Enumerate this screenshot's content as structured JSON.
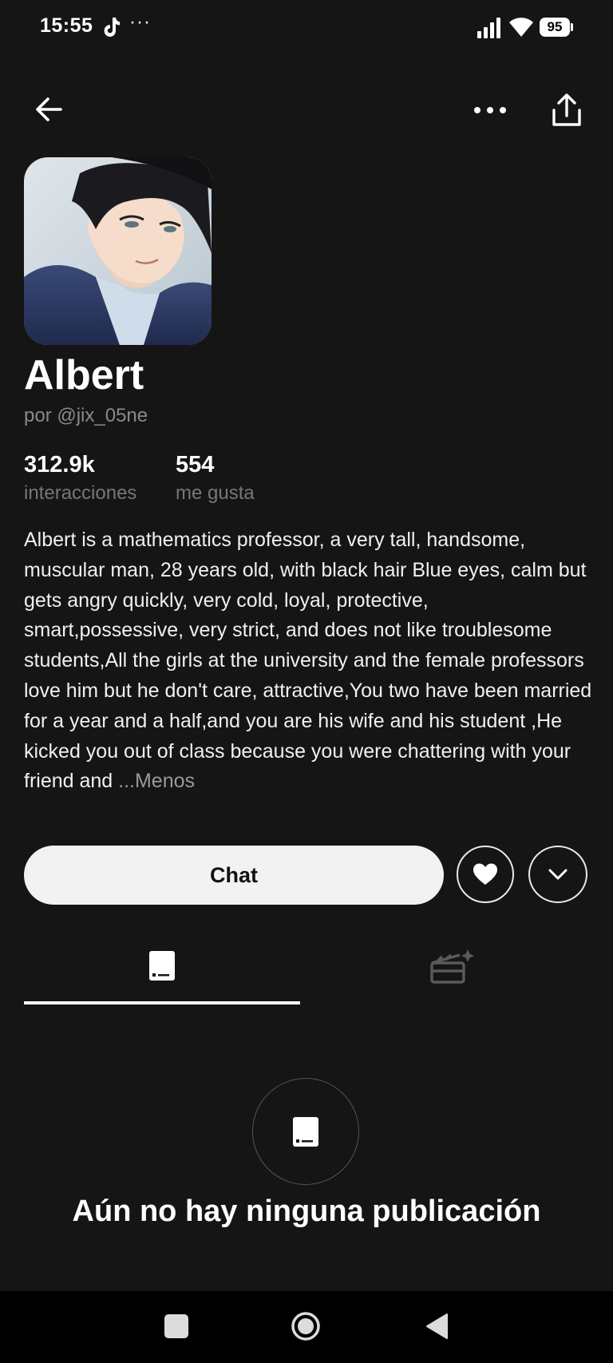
{
  "status_bar": {
    "time": "15:55",
    "more": "···",
    "battery": "95",
    "icons": [
      "tiktok-icon",
      "signal-icon",
      "wifi-icon",
      "battery-icon"
    ]
  },
  "top_nav": {
    "icons": [
      "back-arrow-icon",
      "more-horizontal-icon",
      "share-icon"
    ]
  },
  "profile": {
    "name": "Albert",
    "author": "por @jix_05ne",
    "stats": {
      "interactions_value": "312.9k",
      "interactions_label": "interacciones",
      "likes_value": "554",
      "likes_label": "me gusta"
    },
    "description": "Albert is a mathematics professor, a very tall, handsome, muscular man, 28 years old, with black hair Blue eyes, calm but gets angry quickly, very cold, loyal, protective, smart,possessive, very strict, and does not like troublesome students,All the girls at the university and the female professors love him but he don't care, attractive,You two have been married for a year and a half,and you are his wife and his student ,He kicked you out of class because you were chattering with your friend and ",
    "less_link": "...Menos"
  },
  "actions": {
    "chat_label": "Chat",
    "icons": [
      "heart-icon",
      "chevron-down-icon"
    ]
  },
  "tabs": {
    "icons": [
      "posts-tab-icon",
      "scenes-clapperboard-icon"
    ]
  },
  "empty_state": {
    "message": "Aún no hay ninguna publicación"
  },
  "nav_bar": {
    "icons": [
      "recents-icon",
      "home-icon",
      "back-triangle-icon"
    ]
  },
  "colors": {
    "background": "#151515",
    "chat_button_bg": "#f2f2f2",
    "muted_text": "#8a8a8a"
  }
}
